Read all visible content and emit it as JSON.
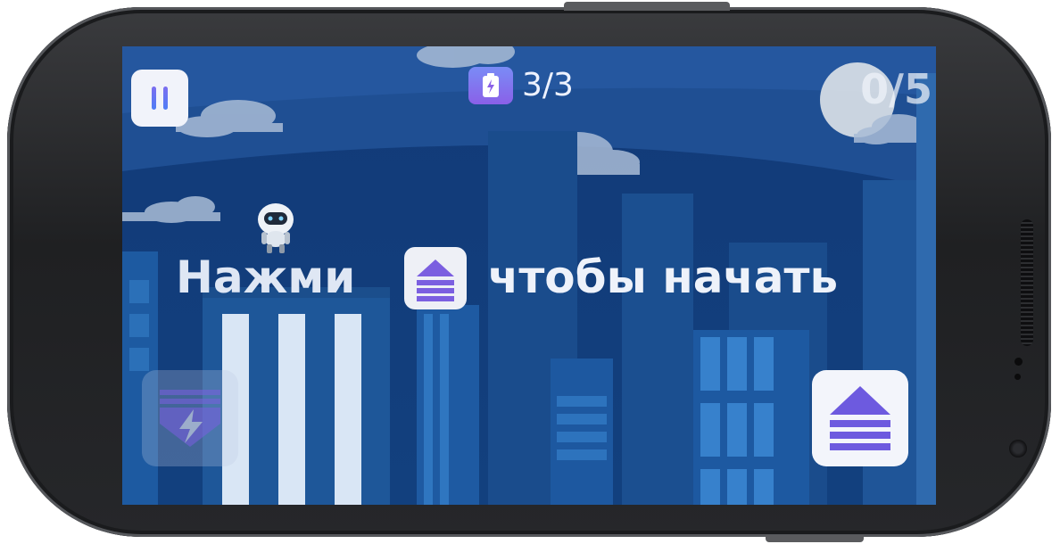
{
  "hud": {
    "energy": "3/3",
    "score": "0/5"
  },
  "hint": {
    "before": "Нажми",
    "after": "чтобы начать"
  },
  "icons": {
    "pause": "pause-icon",
    "battery": "battery-icon",
    "jump": "jump-arrow-icon",
    "power": "lightning-shield-icon",
    "character": "robot"
  },
  "colors": {
    "sky": "#123a78",
    "accent_purple": "#7c6ef0",
    "accent_blue": "#4e7df5",
    "button_light": "#f1f3fa"
  }
}
